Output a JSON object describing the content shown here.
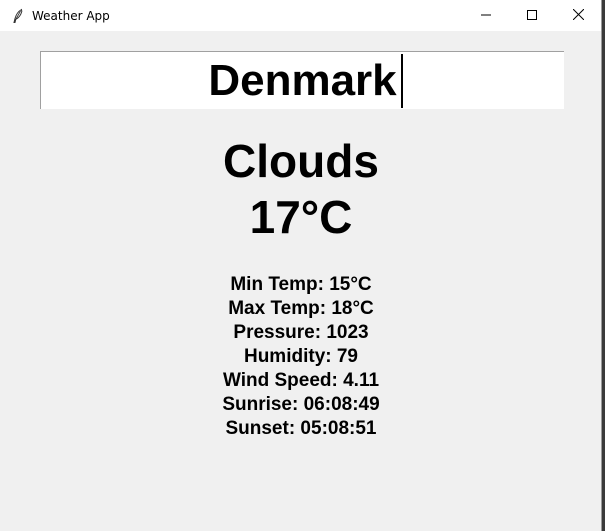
{
  "window": {
    "title": "Weather App",
    "controls": {
      "minimize_icon": "minimize-icon",
      "maximize_icon": "maximize-icon",
      "close_icon": "close-icon"
    }
  },
  "search": {
    "value": "Denmark"
  },
  "weather": {
    "condition": "Clouds",
    "temperature": "17°C",
    "details": [
      "Min Temp: 15°C",
      "Max Temp: 18°C",
      "Pressure: 1023",
      "Humidity: 79",
      "Wind Speed: 4.11",
      "Sunrise: 06:08:49",
      "Sunset: 05:08:51"
    ]
  },
  "colors": {
    "background": "#f0f0f0",
    "titlebar": "#ffffff",
    "text": "#000000"
  }
}
